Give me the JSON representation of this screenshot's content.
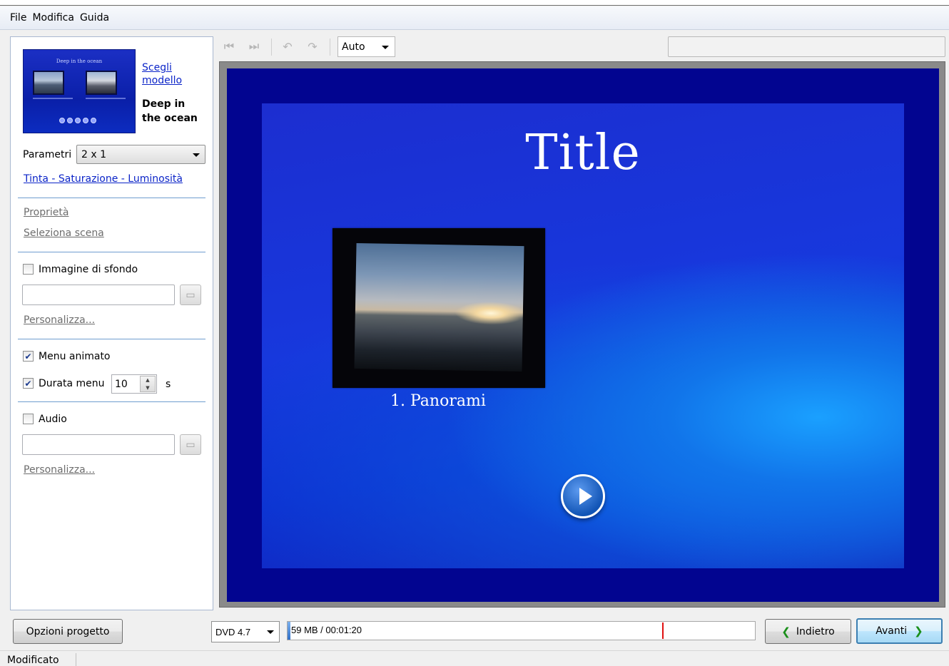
{
  "menubar": {
    "items": [
      "File",
      "Modifica",
      "Guida"
    ]
  },
  "left_panel": {
    "template_thumb_title": "Deep in the ocean",
    "choose_template_link": "Scegli modello",
    "template_name": "Deep in the ocean",
    "params_label": "Parametri",
    "params_value": "2 x 1",
    "hue_link": "Tinta - Saturazione - Luminosità",
    "properties_link": "Proprietà",
    "select_scene_link": "Seleziona scena",
    "background_image": {
      "label": "Immagine di sfondo",
      "checked": false,
      "value": "",
      "customize": "Personalizza..."
    },
    "animated_menu": {
      "label": "Menu animato",
      "checked": true
    },
    "menu_duration": {
      "label": "Durata menu",
      "checked": true,
      "value": "10",
      "unit": "s"
    },
    "audio": {
      "label": "Audio",
      "checked": false,
      "value": "",
      "customize": "Personalizza..."
    }
  },
  "toolbar": {
    "zoom_value": "Auto"
  },
  "preview": {
    "title": "Title",
    "item_caption": "1. Panorami"
  },
  "bottom": {
    "options_button": "Opzioni progetto",
    "disc_value": "DVD 4.7",
    "usage_text": "59 MB / 00:01:20",
    "usage_fraction": 0.006,
    "back_button": "Indietro",
    "next_button": "Avanti"
  },
  "status": {
    "text": "Modificato"
  },
  "colors": {
    "menu_background": "#020590",
    "accent": "#0b24c8",
    "next_arrow": "#1a8f1a",
    "limit_marker": "#e01010"
  }
}
